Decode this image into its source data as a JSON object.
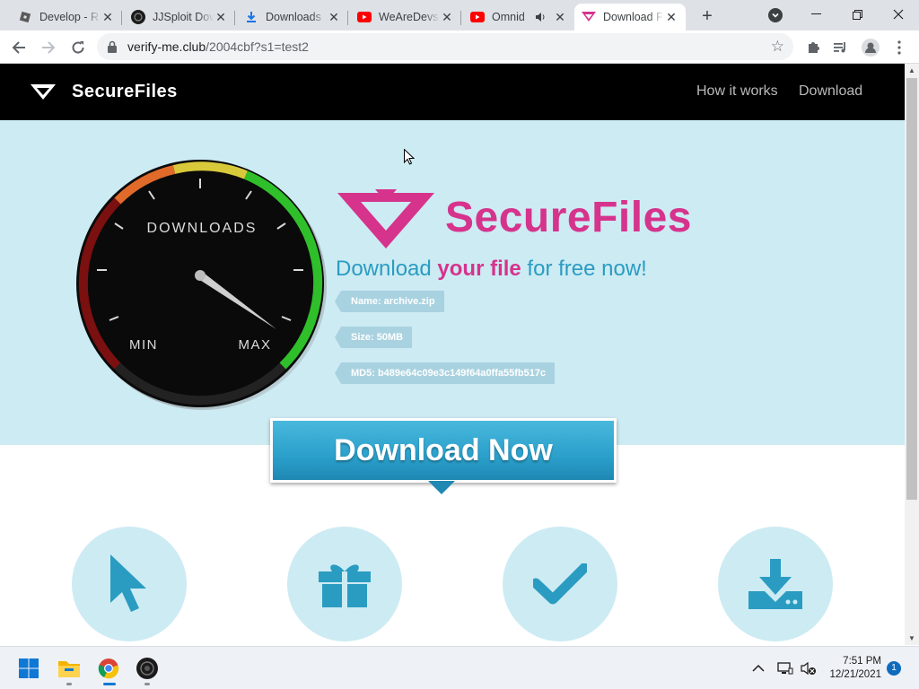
{
  "browser": {
    "tabs": [
      {
        "title": "Develop - R",
        "favicon": "roblox-icon"
      },
      {
        "title": "JJSploit Dow",
        "favicon": "jjsploit-icon"
      },
      {
        "title": "Downloads",
        "favicon": "download-icon"
      },
      {
        "title": "WeAreDevs",
        "favicon": "youtube-icon"
      },
      {
        "title": "Omnid",
        "favicon": "youtube-icon"
      },
      {
        "title": "Download F",
        "favicon": "securefiles-icon"
      }
    ],
    "active_tab_index": 5,
    "url_host": "verify-me.club",
    "url_path": "/2004cbf?s1=test2"
  },
  "site": {
    "brand": "SecureFiles",
    "nav": {
      "how_it_works": "How it works",
      "download": "Download"
    },
    "gauge": {
      "title": "DOWNLOADS",
      "min": "MIN",
      "max": "MAX"
    },
    "hero_brand": "SecureFiles",
    "tagline": {
      "part1": "Download ",
      "highlight": "your file",
      "part2": " for free now!"
    },
    "file_info": {
      "name": "Name: archive.zip",
      "size": "Size: 50MB",
      "md5": "MD5: b489e64c09e3c149f64a0ffa55fb517c"
    },
    "download_button": "Download Now",
    "features": [
      "cursor-icon",
      "gift-icon",
      "checkmark-icon",
      "download-tray-icon"
    ],
    "colors": {
      "brand_pink": "#d6338c",
      "accent_blue": "#2a9cc2",
      "hero_bg": "#cdebf3",
      "nav_bg": "#000000"
    }
  },
  "taskbar": {
    "time": "7:51 PM",
    "date": "12/21/2021",
    "notifications": "1"
  }
}
